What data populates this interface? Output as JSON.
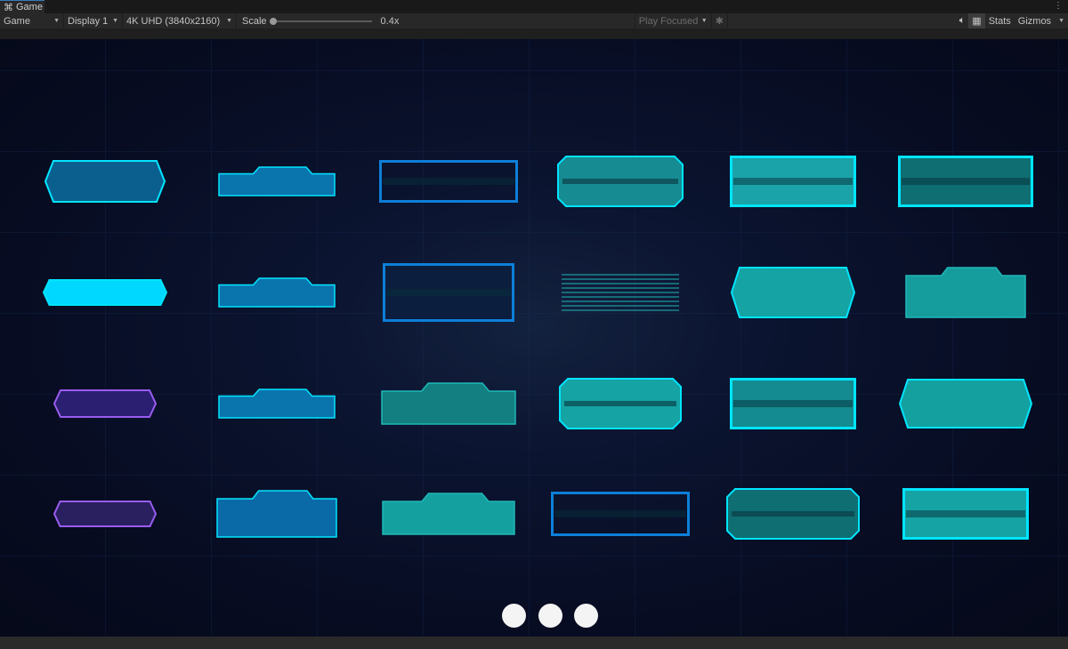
{
  "tab": {
    "title": "Game",
    "icon": "gamepad-icon"
  },
  "toolbar": {
    "view_mode": "Game",
    "display": "Display 1",
    "resolution": "4K UHD (3840x2160)",
    "scale_label": "Scale",
    "scale_value": "0.4x",
    "play_mode": "Play Focused",
    "stats": "Stats",
    "gizmos": "Gizmos"
  },
  "colors": {
    "cyan": "#00e5ff",
    "teal": "#1fb8b8",
    "blue": "#0d7fd8",
    "purple": "#9a5cf0"
  },
  "pagination": {
    "pages": 3
  }
}
